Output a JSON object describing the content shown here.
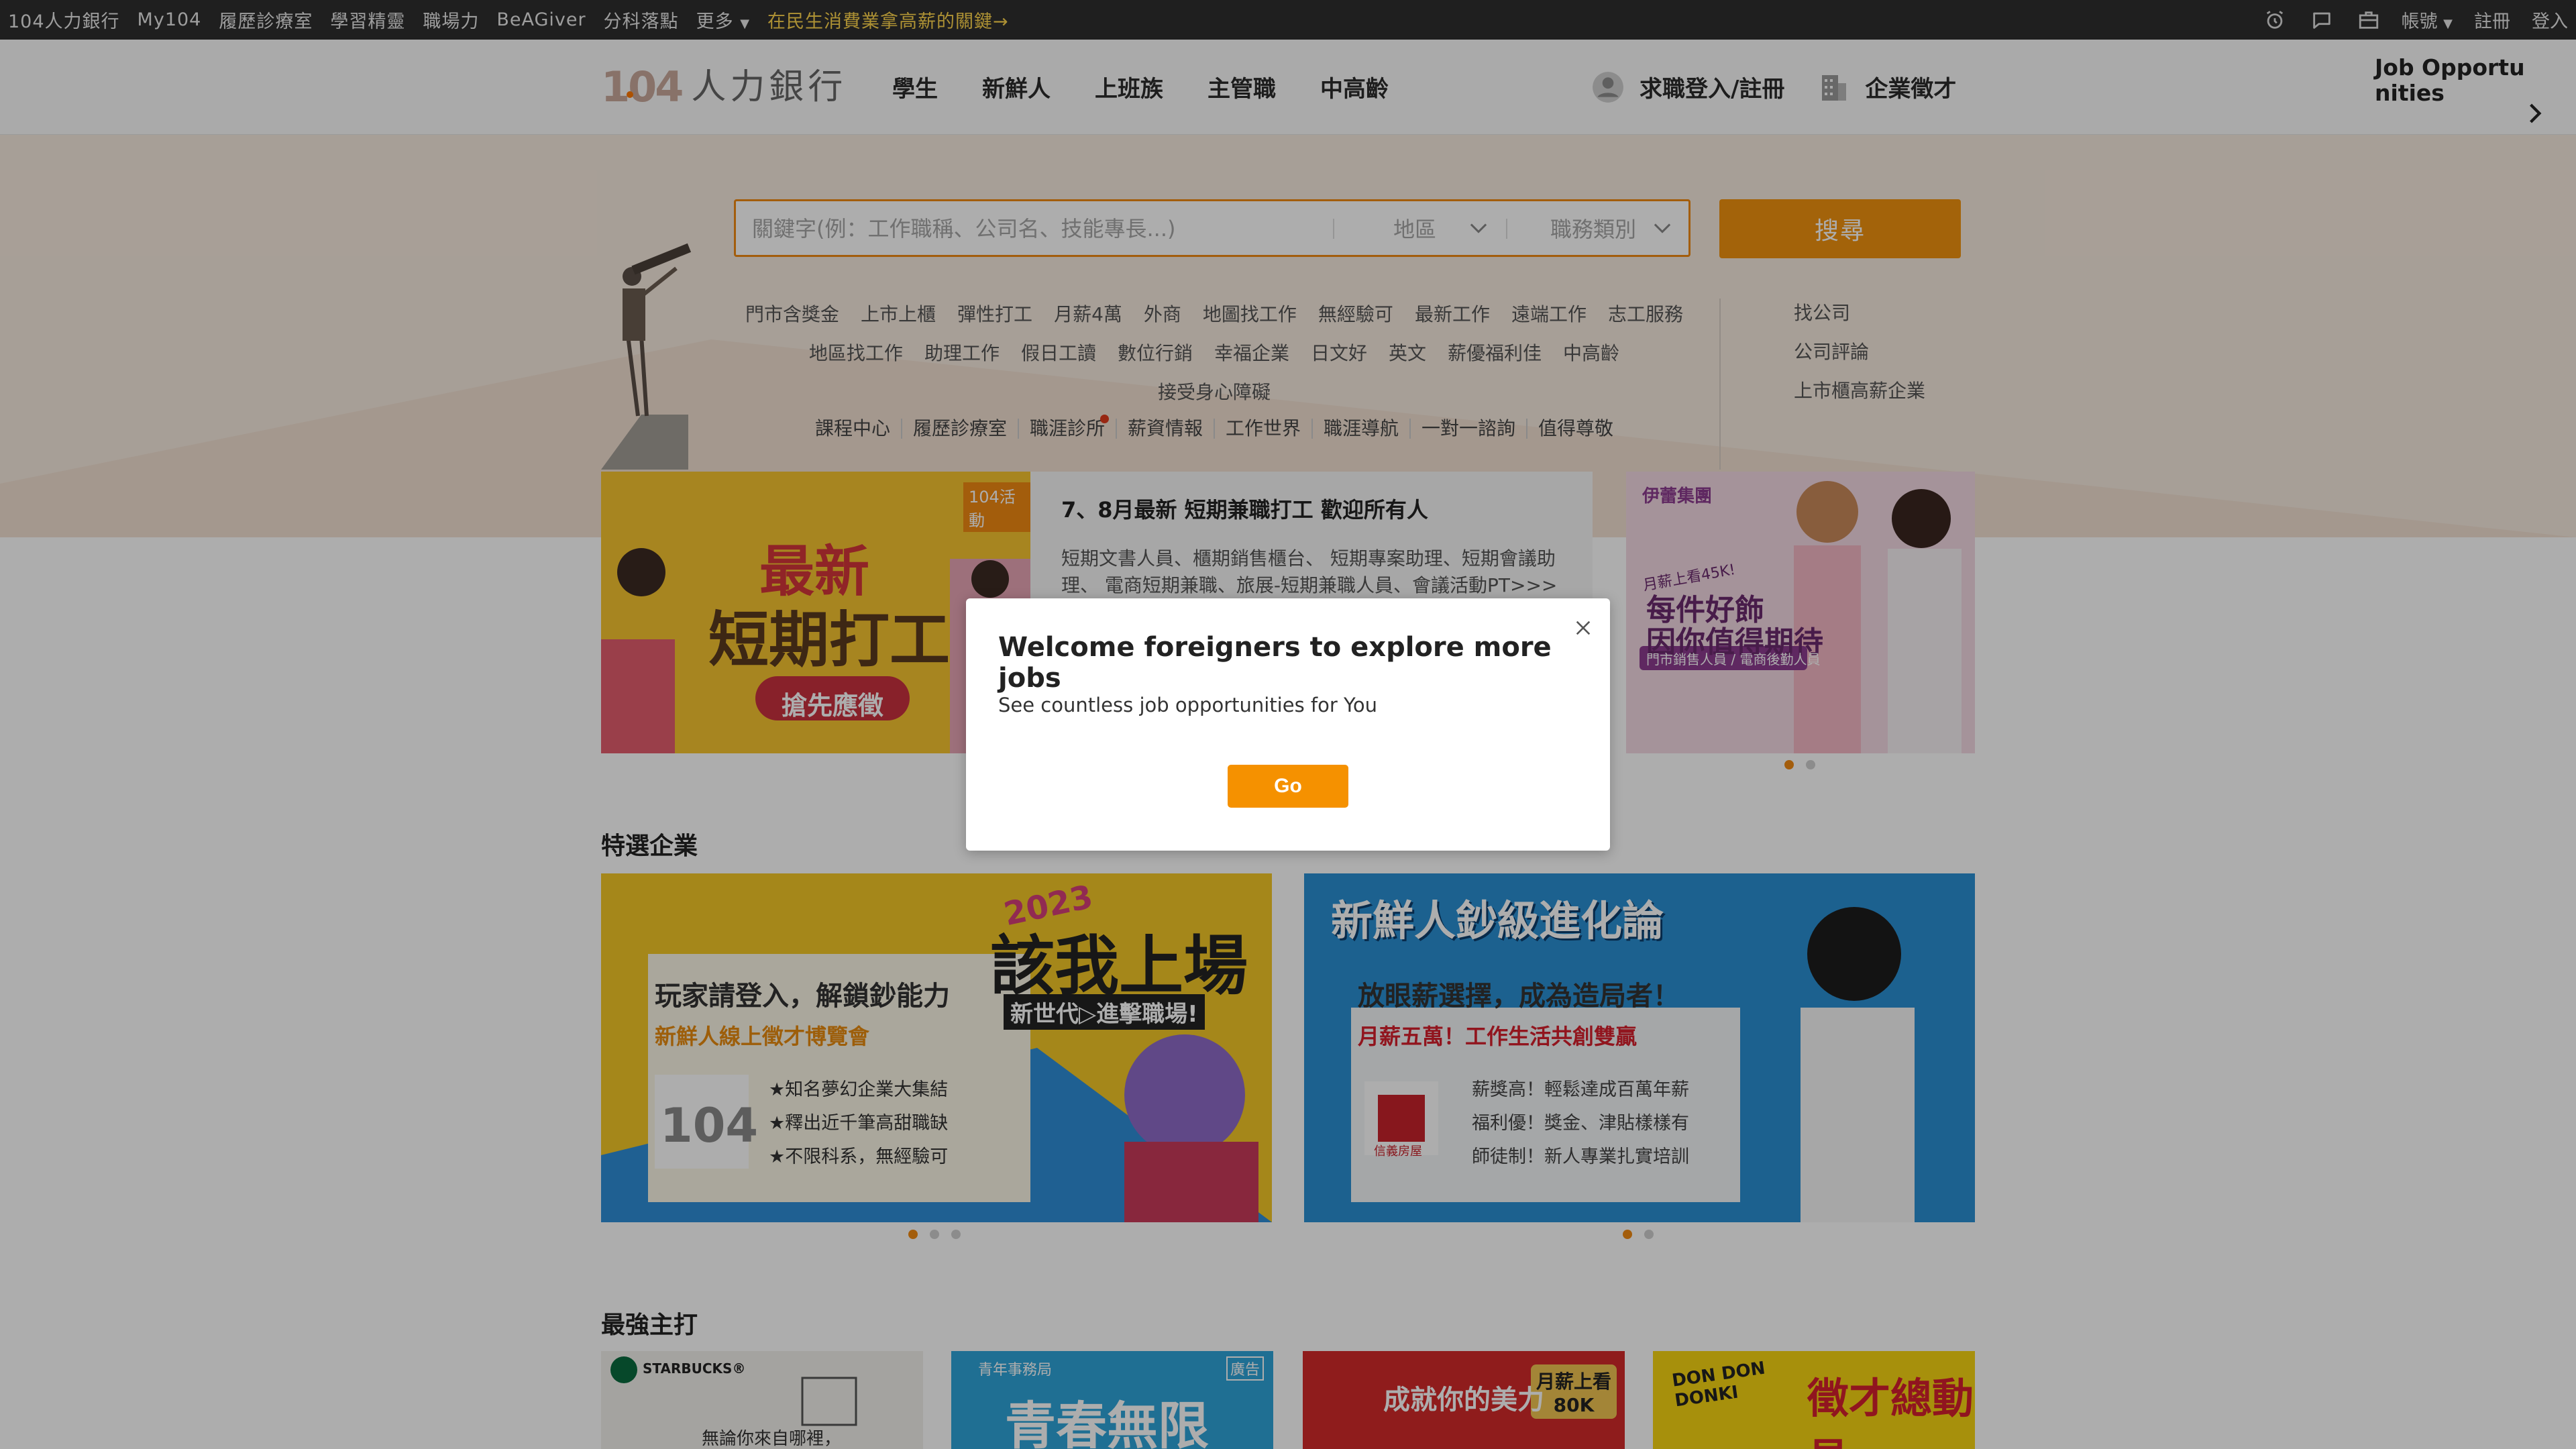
{
  "topbar": {
    "links": [
      "104人力銀行",
      "My104",
      "履歷診療室",
      "學習精靈",
      "職場力",
      "BeAGiver",
      "分科落點",
      "更多"
    ],
    "promo": "在民生消費業拿高薪的關鍵→",
    "right": {
      "account": "帳號",
      "register": "註冊",
      "login": "登入"
    }
  },
  "header": {
    "logo_num": "104",
    "logo_text": "人力銀行",
    "nav": [
      "學生",
      "新鮮人",
      "上班族",
      "主管職",
      "中高齡"
    ],
    "jobseeker_login": "求職登入/註冊",
    "employer": "企業徵才",
    "job_opportunities": "Job Opportunities"
  },
  "search": {
    "placeholder": "關鍵字(例：工作職稱、公司名、技能專長...)",
    "area": "地區",
    "category": "職務類別",
    "button": "搜尋"
  },
  "keywords": {
    "row1": [
      "門市含獎金",
      "上市上櫃",
      "彈性打工",
      "月薪4萬",
      "外商",
      "地圖找工作",
      "無經驗可",
      "最新工作",
      "遠端工作",
      "志工服務"
    ],
    "row2": [
      "地區找工作",
      "助理工作",
      "假日工讀",
      "數位行銷",
      "幸福企業",
      "日文好",
      "英文",
      "薪優福利佳",
      "中高齡"
    ],
    "row3": [
      "接受身心障礙"
    ],
    "side": [
      "找公司",
      "公司評論",
      "上市櫃高薪企業"
    ],
    "sub": [
      "課程中心",
      "履歷診療室",
      "職涯診所",
      "薪資情報",
      "工作世界",
      "職涯導航",
      "一對一諮詢",
      "值得尊敬"
    ]
  },
  "banner": {
    "tag": "104活動",
    "img_title_1": "最新",
    "img_title_2": "短期打工",
    "img_button": "搶先應徵",
    "title": "7、8月最新 短期兼職打工 歡迎所有人",
    "desc": "短期文書人員、櫃期銷售櫃台、 短期專案助理、短期會議助理、 電商短期兼職、旅展-短期兼職人員、會議活動PT>>>"
  },
  "ad_right": {
    "brand": "伊蕾集團",
    "line1": "月薪上看45K!",
    "line2": "每件好飾",
    "line3": "因你值得期待",
    "line4": "門市銷售人員 / 電商後勤人員"
  },
  "featured": {
    "title": "特選企業",
    "card1": {
      "year": "2023",
      "big": "該我上場",
      "tagline": "新世代▷進擊職場!",
      "headline": "玩家請登入，解鎖鈔能力",
      "sub": "新鮮人線上徵才博覽會",
      "logo": "104",
      "points": [
        "★知名夢幻企業大集結",
        "★釋出近千筆高甜職缺",
        "★不限科系，無經驗可"
      ]
    },
    "card2": {
      "banner": "新鮮人鈔級進化論",
      "headline": "放眼薪選擇，成為造局者！",
      "sub": "月薪五萬！工作生活共創雙贏",
      "logo": "信義房屋",
      "points": [
        "薪獎高！輕鬆達成百萬年薪",
        "福利優！獎金、津貼樣樣有",
        "師徒制！新人專業扎實培訓"
      ]
    }
  },
  "strongest": {
    "title": "最強主打",
    "cards": [
      {
        "brand": "STARBUCKS®",
        "text": "無論你來自哪裡，"
      },
      {
        "brand": "青年事務局",
        "text": "青春無限",
        "tag": "廣告"
      },
      {
        "brand": "",
        "text": "成就你的美力",
        "badge": "月薪上看 80K"
      },
      {
        "brand": "DON DON DONKI",
        "text": "徵才總動員"
      }
    ]
  },
  "modal": {
    "title": "Welcome foreigners to explore more jobs",
    "subtitle": "See countless job opportunities for You",
    "button": "Go"
  }
}
